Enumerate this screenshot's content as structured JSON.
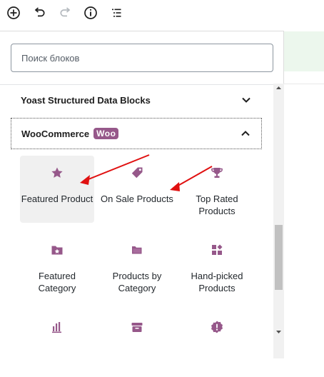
{
  "toolbar": {
    "icons": [
      "add-block-icon",
      "undo-icon",
      "redo-icon",
      "info-icon",
      "outline-icon"
    ]
  },
  "search": {
    "placeholder": "Поиск блоков",
    "value": ""
  },
  "panels": [
    {
      "title": "Yoast Structured Data Blocks",
      "expanded": false,
      "icon": "chevron-down-icon"
    },
    {
      "title": "WooCommerce",
      "badge": "Woo",
      "expanded": true,
      "icon": "chevron-up-icon"
    }
  ],
  "blocks": [
    {
      "label": "Featured Product",
      "icon": "star-icon"
    },
    {
      "label": "On Sale Products",
      "icon": "tag-icon"
    },
    {
      "label": "Top Rated Products",
      "icon": "trophy-icon"
    },
    {
      "label": "Featured Category",
      "icon": "folder-star-icon"
    },
    {
      "label": "Products by Category",
      "icon": "folder-icon"
    },
    {
      "label": "Hand-picked Products",
      "icon": "grid-icon"
    },
    {
      "label": "",
      "icon": "bar-chart-icon"
    },
    {
      "label": "",
      "icon": "archive-icon"
    },
    {
      "label": "",
      "icon": "badge-icon"
    }
  ],
  "colors": {
    "woo_purple": "#96588a",
    "arrow_red": "#e01010",
    "toolbar_dark": "#1e1e1e"
  }
}
